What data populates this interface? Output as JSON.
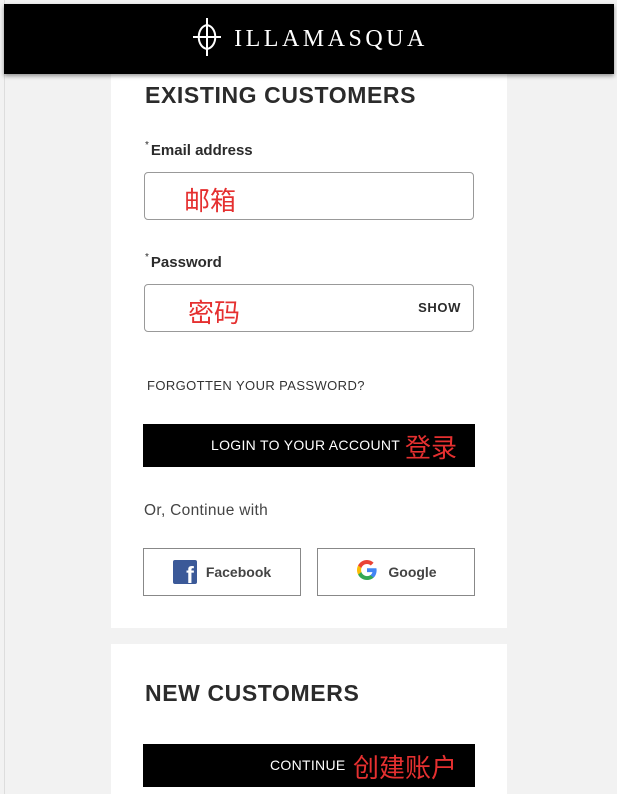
{
  "header": {
    "brand": "ILLAMASQUA",
    "logo_icon": "illamasqua-emblem-icon"
  },
  "existing": {
    "title": "EXISTING CUSTOMERS",
    "email": {
      "required_mark": "*",
      "label": "Email address",
      "placeholder": "邮箱"
    },
    "password": {
      "required_mark": "*",
      "label": "Password",
      "placeholder": "密码",
      "show_label": "SHOW"
    },
    "forgot": "FORGOTTEN YOUR PASSWORD?",
    "login_button": {
      "label": "LOGIN TO YOUR ACCOUNT",
      "annotation": "登录"
    },
    "or_text": "Or, Continue with",
    "social": [
      {
        "label": "Facebook",
        "icon": "facebook-icon",
        "color": "#3b5998"
      },
      {
        "label": "Google",
        "icon": "google-icon"
      }
    ]
  },
  "new_customers": {
    "title": "NEW CUSTOMERS",
    "continue_button": {
      "label": "CONTINUE",
      "annotation": "创建账户"
    }
  },
  "colors": {
    "header_bg": "#000000",
    "annotation_red": "#e53030",
    "page_bg": "#f2f2f2"
  }
}
